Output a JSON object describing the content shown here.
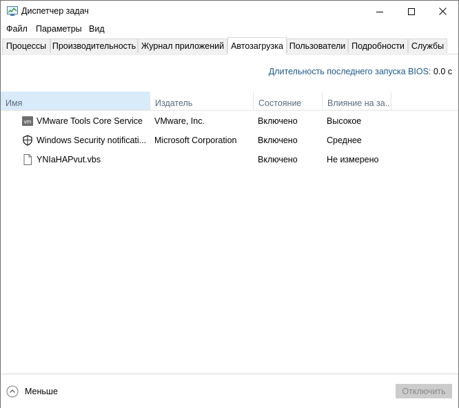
{
  "window": {
    "title": "Диспетчер задач"
  },
  "menu": {
    "items": [
      "Файл",
      "Параметры",
      "Вид"
    ]
  },
  "tabs": [
    {
      "label": "Процессы",
      "active": false
    },
    {
      "label": "Производительность",
      "active": false
    },
    {
      "label": "Журнал приложений",
      "active": false
    },
    {
      "label": "Автозагрузка",
      "active": true
    },
    {
      "label": "Пользователи",
      "active": false
    },
    {
      "label": "Подробности",
      "active": false
    },
    {
      "label": "Службы",
      "active": false
    }
  ],
  "bios": {
    "label": "Длительность последнего запуска BIOS:",
    "value": "0.0 с"
  },
  "table": {
    "columns": [
      "Имя",
      "Издатель",
      "Состояние",
      "Влияние на за..."
    ],
    "sorted_column": "Имя",
    "rows": [
      {
        "icon": "vmware-icon",
        "name": "VMware Tools Core Service",
        "publisher": "VMware, Inc.",
        "status": "Включено",
        "impact": "Высокое"
      },
      {
        "icon": "shield-icon",
        "name": "Windows Security notificati...",
        "publisher": "Microsoft Corporation",
        "status": "Включено",
        "impact": "Среднее"
      },
      {
        "icon": "file-icon",
        "name": "YNIaHAPvut.vbs",
        "publisher": "",
        "status": "Включено",
        "impact": "Не измерено"
      }
    ]
  },
  "footer": {
    "less_label": "Меньше",
    "disable_label": "Отключить"
  },
  "colors": {
    "link_text": "#1e5a8c",
    "sorted_header_bg": "#d9ebf9",
    "disabled_button_bg": "#cccccc"
  }
}
